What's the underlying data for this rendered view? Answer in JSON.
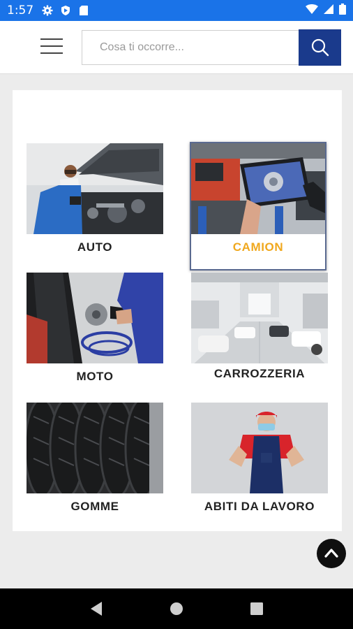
{
  "status_bar": {
    "time": "1:57",
    "left_icons": [
      "gear-icon",
      "shield-icon",
      "sd-card-icon"
    ],
    "right_icons": [
      "wifi-icon",
      "signal-icon",
      "battery-icon"
    ]
  },
  "header": {
    "menu_icon": "hamburger-menu-icon",
    "search_placeholder": "Cosa ti occorre...",
    "search_value": "",
    "search_icon": "search-icon",
    "accent_color": "#1a3a8c"
  },
  "categories": [
    {
      "label": "AUTO",
      "image": "mechanic-under-car-hood"
    },
    {
      "label": "CAMION",
      "image": "truck-workshop-tablet",
      "active": true
    },
    {
      "label": "MOTO",
      "image": "motorcycle-wheel-impact-wrench"
    },
    {
      "label": "CARROZZERIA",
      "image": "bodyshop-interior"
    },
    {
      "label": "GOMME",
      "image": "tire-stack"
    },
    {
      "label": "ABITI DA LAVORO",
      "image": "worker-in-overalls"
    }
  ],
  "active_label_color": "#f0a81e",
  "scroll_top_icon": "chevron-up-icon",
  "nav_bar": {
    "icons": [
      "back-icon",
      "home-icon",
      "recents-icon"
    ]
  }
}
